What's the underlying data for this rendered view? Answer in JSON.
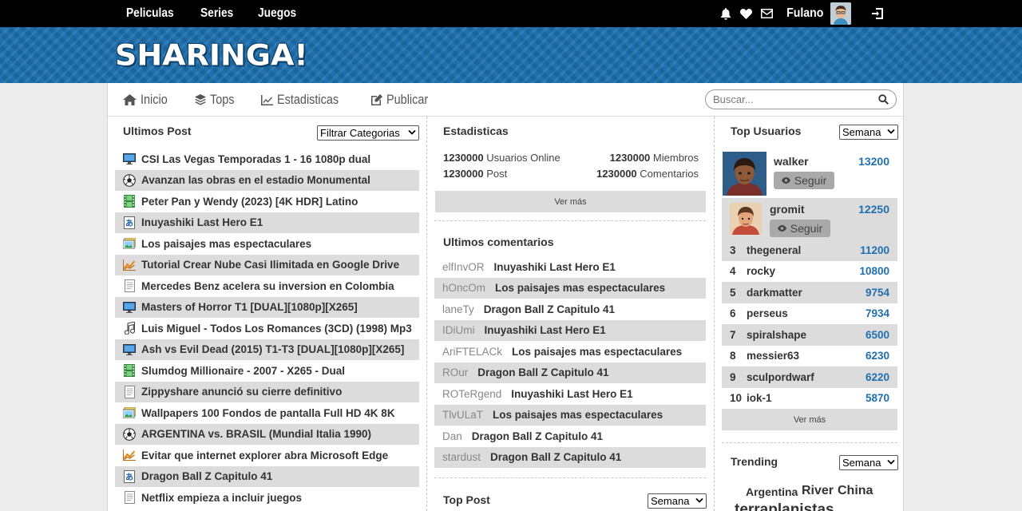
{
  "topnav": {
    "items": [
      "Peliculas",
      "Series",
      "Juegos"
    ]
  },
  "user": {
    "name": "Fulano"
  },
  "brand": {
    "logo": "SHARINGA!"
  },
  "subnav": {
    "inicio": "Inicio",
    "tops": "Tops",
    "estadisticas": "Estadisticas",
    "publicar": "Publicar"
  },
  "search": {
    "placeholder": "Buscar..."
  },
  "ultimos_post": {
    "title": "Ultimos Post",
    "filter": "Filtrar Categorias",
    "items": [
      {
        "icon": "monitor-icon",
        "title": "CSI Las Vegas Temporadas 1 - 16 1080p dual"
      },
      {
        "icon": "soccer-ball-icon",
        "title": "Avanzan las obras en el estadio Monumental"
      },
      {
        "icon": "film-icon",
        "title": "Peter Pan y Wendy (2023) [4K HDR] Latino"
      },
      {
        "icon": "anime-icon",
        "title": "Inuyashiki Last Hero E1"
      },
      {
        "icon": "image-icon",
        "title": "Los paisajes mas espectaculares"
      },
      {
        "icon": "tutorial-icon",
        "title": "Tutorial Crear Nube Casi Ilimitada en Google Drive"
      },
      {
        "icon": "document-icon",
        "title": "Mercedes Benz acelera su inversion en Colombia"
      },
      {
        "icon": "monitor-icon",
        "title": "Masters of Horror T1 [DUAL][1080p][X265]"
      },
      {
        "icon": "music-icon",
        "title": "Luis Miguel - Todos Los Romances (3CD) (1998) Mp3"
      },
      {
        "icon": "monitor-icon",
        "title": "Ash vs Evil Dead (2015) T1-T3 [DUAL][1080p][X265]"
      },
      {
        "icon": "film-icon",
        "title": "Slumdog Millionaire - 2007 - X265 - Dual"
      },
      {
        "icon": "document-icon",
        "title": "Zippyshare anunció su cierre definitivo"
      },
      {
        "icon": "image-icon",
        "title": "Wallpapers 100 Fondos de pantalla Full HD 4K 8K"
      },
      {
        "icon": "soccer-ball-icon",
        "title": "ARGENTINA vs. BRASIL (Mundial Italia 1990)"
      },
      {
        "icon": "tutorial-icon",
        "title": "Evitar que internet explorer abra Microsoft Edge"
      },
      {
        "icon": "anime-icon",
        "title": "Dragon Ball Z Capitulo 41"
      },
      {
        "icon": "document-icon",
        "title": "Netflix empieza a incluir juegos"
      }
    ]
  },
  "estadisticas": {
    "title": "Estadisticas",
    "online_value": "1230000",
    "online_label": "Usuarios Online",
    "members_value": "1230000",
    "members_label": "Miembros",
    "posts_value": "1230000",
    "posts_label": "Post",
    "comments_value": "1230000",
    "comments_label": "Comentarios",
    "more": "Ver más"
  },
  "ultimos_comentarios": {
    "title": "Ultimos comentarios",
    "items": [
      {
        "user": "elfInvOR",
        "post": "Inuyashiki Last Hero E1"
      },
      {
        "user": "hOncOm",
        "post": "Los paisajes mas espectaculares"
      },
      {
        "user": "laneTy",
        "post": "Dragon Ball Z Capitulo 41"
      },
      {
        "user": "IDiUmi",
        "post": "Inuyashiki Last Hero E1"
      },
      {
        "user": "AriFTELACk",
        "post": "Los paisajes mas espectaculares"
      },
      {
        "user": "ROur",
        "post": "Dragon Ball Z Capitulo 41"
      },
      {
        "user": "ROTeRgend",
        "post": "Inuyashiki Last Hero E1"
      },
      {
        "user": "TlvULaT",
        "post": "Los paisajes mas espectaculares"
      },
      {
        "user": "Dan",
        "post": "Dragon Ball Z Capitulo 41"
      },
      {
        "user": "stardust",
        "post": "Dragon Ball Z Capitulo 41"
      }
    ]
  },
  "top_post": {
    "title": "Top Post",
    "period": "Semana"
  },
  "top_usuarios": {
    "title": "Top Usuarios",
    "period": "Semana",
    "follow_label": "Seguir",
    "featured": [
      {
        "name": "walker",
        "score": "13200"
      },
      {
        "name": "gromit",
        "score": "12250"
      }
    ],
    "ranking": [
      {
        "rank": "3",
        "name": "thegeneral",
        "score": "11200"
      },
      {
        "rank": "4",
        "name": "rocky",
        "score": "10800"
      },
      {
        "rank": "5",
        "name": "darkmatter",
        "score": "9754"
      },
      {
        "rank": "6",
        "name": "perseus",
        "score": "7934"
      },
      {
        "rank": "7",
        "name": "spiralshape",
        "score": "6500"
      },
      {
        "rank": "8",
        "name": "messier63",
        "score": "6230"
      },
      {
        "rank": "9",
        "name": "sculpordwarf",
        "score": "6220"
      },
      {
        "rank": "10",
        "name": "iok-1",
        "score": "5870"
      }
    ],
    "more": "Ver más"
  },
  "trending": {
    "title": "Trending",
    "period": "Semana",
    "tags": [
      "Argentina",
      "River",
      "China",
      "terraplanistas"
    ]
  }
}
